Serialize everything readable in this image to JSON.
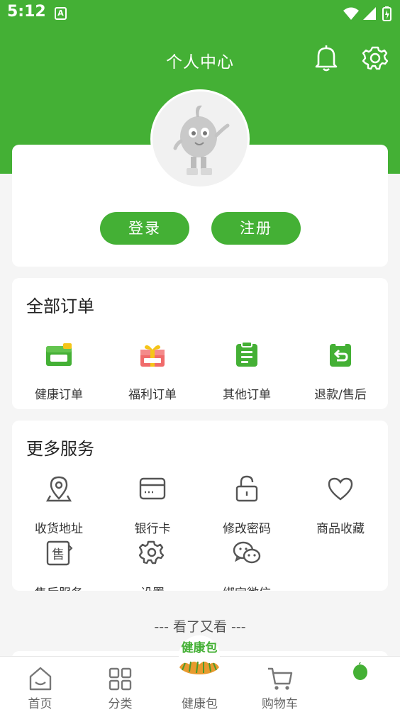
{
  "status_bar": {
    "time": "5:12",
    "notification_letter": "A"
  },
  "header": {
    "title": "个人中心",
    "bell_icon": "bell-icon",
    "settings_icon": "gear-icon"
  },
  "auth": {
    "login_label": "登录",
    "register_label": "注册"
  },
  "orders": {
    "title": "全部订单",
    "items": [
      {
        "label": "健康订单",
        "icon": "health-order-icon"
      },
      {
        "label": "福利订单",
        "icon": "gift-icon"
      },
      {
        "label": "其他订单",
        "icon": "clipboard-icon"
      },
      {
        "label": "退款/售后",
        "icon": "refund-icon"
      }
    ]
  },
  "services": {
    "title": "更多服务",
    "items": [
      {
        "label": "收货地址",
        "icon": "map-pin-icon"
      },
      {
        "label": "银行卡",
        "icon": "bank-card-icon"
      },
      {
        "label": "修改密码",
        "icon": "lock-icon"
      },
      {
        "label": "商品收藏",
        "icon": "heart-icon"
      },
      {
        "label": "售后服务",
        "icon": "after-sale-icon"
      },
      {
        "label": "设置",
        "icon": "gear-icon"
      },
      {
        "label": "绑定微信",
        "icon": "wechat-icon"
      }
    ]
  },
  "more_section": {
    "title": "--- 看了又看 ---"
  },
  "tabbar": {
    "tabs": [
      {
        "label": "首页",
        "icon": "home-icon"
      },
      {
        "label": "分类",
        "icon": "category-icon"
      },
      {
        "label": "健康包",
        "icon": "health-pack-icon"
      },
      {
        "label": "购物车",
        "icon": "cart-icon"
      },
      {
        "label": "",
        "icon": "profile-icon"
      }
    ],
    "badge_text": "健康包"
  },
  "colors": {
    "brand_green": "#44b035",
    "background": "#f5f5f5"
  }
}
